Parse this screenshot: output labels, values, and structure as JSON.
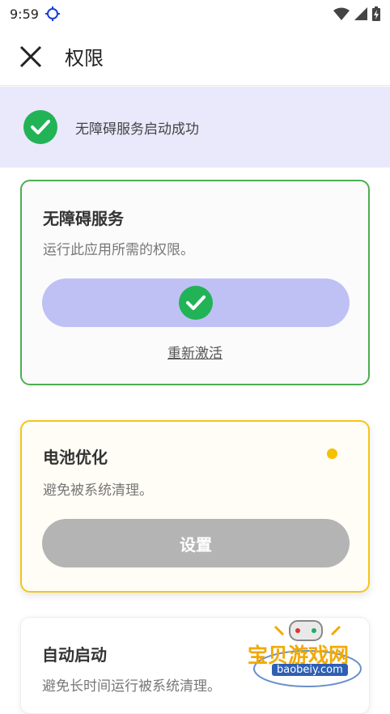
{
  "status_bar": {
    "time": "9:59",
    "icons": [
      "location-target-icon",
      "wifi-icon",
      "signal-icon",
      "battery-charging-icon"
    ]
  },
  "app_bar": {
    "title": "权限",
    "close_icon": "close-icon"
  },
  "banner": {
    "text": "无障碍服务启动成功",
    "icon": "check-circle-icon",
    "accent": "#22b357"
  },
  "cards": [
    {
      "title": "无障碍服务",
      "description": "运行此应用所需的权限。",
      "status": "done",
      "action_icon": "check-circle-icon",
      "link_label": "重新激活",
      "border_color": "#4caf50"
    },
    {
      "title": "电池优化",
      "description": "避免被系统清理。",
      "status": "pending",
      "button_label": "设置",
      "border_color": "#f5c518",
      "dot_color": "#f5c000"
    },
    {
      "title": "自动启动",
      "description": "避免长时间运行被系统清理。"
    }
  ],
  "watermark": {
    "text": "宝贝游戏网",
    "url_text": "baobeiy.com"
  }
}
